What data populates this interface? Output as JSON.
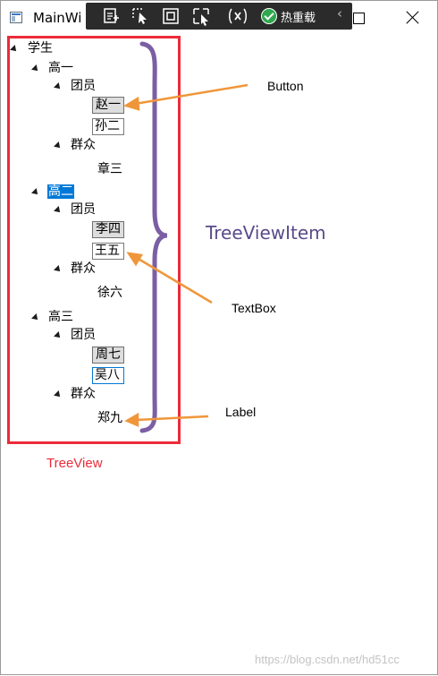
{
  "window": {
    "title": "MainWi",
    "devtools": {
      "hot_reload_label": "热重载"
    }
  },
  "tree": {
    "root": {
      "label": "学生"
    },
    "grades": [
      {
        "label": "高一",
        "selected": false,
        "groups": [
          {
            "label": "团员",
            "items": [
              {
                "kind": "button",
                "text": "赵一"
              },
              {
                "kind": "textbox",
                "text": "孙二"
              }
            ]
          },
          {
            "label": "群众",
            "items": [
              {
                "kind": "label",
                "text": "章三"
              }
            ]
          }
        ]
      },
      {
        "label": "高二",
        "selected": true,
        "groups": [
          {
            "label": "团员",
            "items": [
              {
                "kind": "button",
                "text": "李四"
              },
              {
                "kind": "textbox",
                "text": "王五"
              }
            ]
          },
          {
            "label": "群众",
            "items": [
              {
                "kind": "label",
                "text": "徐六"
              }
            ]
          }
        ]
      },
      {
        "label": "高三",
        "selected": false,
        "groups": [
          {
            "label": "团员",
            "items": [
              {
                "kind": "button",
                "text": "周七"
              },
              {
                "kind": "textbox",
                "text": "吴八"
              }
            ]
          },
          {
            "label": "群众",
            "items": [
              {
                "kind": "label",
                "text": "郑九"
              }
            ]
          }
        ]
      }
    ]
  },
  "annotations": {
    "button": "Button",
    "textbox": "TextBox",
    "label": "Label",
    "treeviewitem": "TreeViewItem",
    "treeview": "TreeView"
  },
  "colors": {
    "frame_red": "#ec2b3a",
    "arrow_orange": "#f0963a",
    "brace_purple": "#7b5ea3",
    "selection_blue": "#0078d7"
  },
  "watermark": "https://blog.csdn.net/hd51cc"
}
